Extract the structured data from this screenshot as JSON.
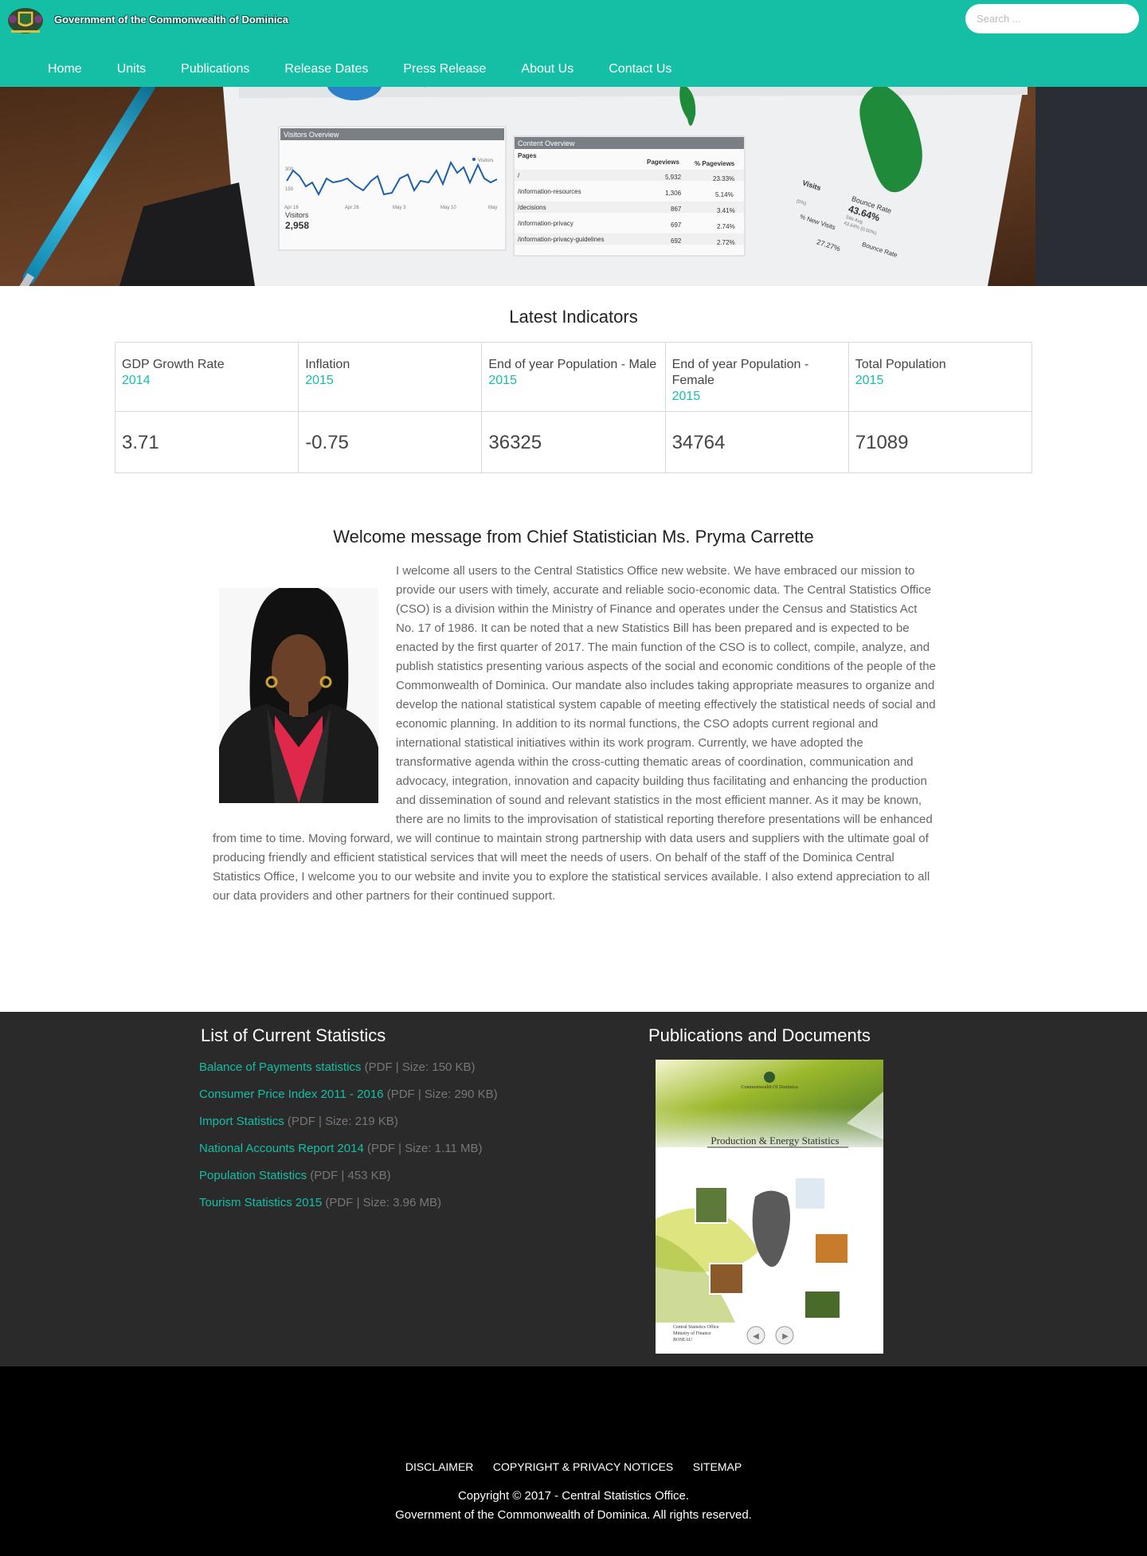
{
  "header": {
    "site_title": "Government of the Commonwealth of Dominica",
    "search_placeholder": "Search ...",
    "nav": [
      "Home",
      "Units",
      "Publications",
      "Release Dates",
      "Press Release",
      "About Us",
      "Contact Us"
    ]
  },
  "hero": {
    "visitors_title": "Visitors Overview",
    "visitors_label": "Visitors",
    "visitors_value": "2,958",
    "visitors_legend": "Visitors",
    "chart_y_ticks": [
      "300",
      "150"
    ],
    "chart_x_ticks": [
      "Apr 16",
      "Apr 26",
      "May 3",
      "May 10",
      "May"
    ],
    "content_title": "Content Overview",
    "content_headers": [
      "Pages",
      "Pageviews",
      "% Pageviews"
    ],
    "content_rows": [
      [
        "/",
        "5,932",
        "23.33%"
      ],
      [
        "/information-resources",
        "1,306",
        "5.14%"
      ],
      [
        "/decisions",
        "867",
        "3.41%"
      ],
      [
        "/information-privacy",
        "697",
        "2.74%"
      ],
      [
        "/information-privacy-guidelines",
        "692",
        "2.72%"
      ]
    ],
    "visits_label": "Visits",
    "bounce_label": "Bounce Rate",
    "bounce_value": "43.64%",
    "bounce_sub": "Site Avg",
    "bounce_avg": "43.64% (0.00%)",
    "new_visits_label": "% New Visits",
    "new_visits_value": "27.27%",
    "bounce_label_2": "Bounce Rate",
    "small_pct": "(0%)",
    "arrow_glyph": "»"
  },
  "indicators": {
    "title": "Latest Indicators",
    "items": [
      {
        "label": "GDP Growth Rate",
        "year": "2014",
        "value": "3.71"
      },
      {
        "label": "Inflation",
        "year": "2015",
        "value": "-0.75"
      },
      {
        "label": "End of year Population - Male",
        "year": "2015",
        "value": "36325"
      },
      {
        "label": "End of year Population - Female",
        "year": "2015",
        "value": "34764"
      },
      {
        "label": "Total Population",
        "year": "2015",
        "value": "71089"
      }
    ]
  },
  "welcome": {
    "title": "Welcome message from Chief Statistician Ms. Pryma Carrette",
    "body": " I welcome all users to the Central Statistics Office new website. We have embraced our mission to provide our users with timely, accurate and reliable socio-economic data. The Central Statistics Office (CSO) is a division within the Ministry of Finance and operates under the Census and Statistics Act No. 17 of 1986. It can be noted that a new Statistics Bill has been prepared and is expected to be enacted by the first quarter of 2017. The main function of the CSO is to collect, compile, analyze, and publish statistics presenting various aspects of the social and economic conditions of the people of the Commonwealth of Dominica. Our mandate also includes taking appropriate measures to organize and develop the national statistical system capable of meeting effectively the statistical needs of social and economic planning. In addition to its normal functions, the CSO adopts current regional and international statistical initiatives within its work program. Currently, we have adopted the transformative agenda within the cross-cutting thematic areas of coordination, communication and advocacy, integration, innovation and capacity building thus facilitating and enhancing the production and dissemination of sound and relevant statistics in the most efficient manner. As it may be known, there are no limits to the improvisation of statistical reporting therefore presentations will be enhanced from time to time. Moving forward, we will continue to maintain strong partnership with data users and suppliers with the ultimate goal of producing friendly and efficient statistical services that will meet the needs of users. On behalf of the staff of the Dominica Central Statistics Office, I welcome you to our website and invite you to explore the statistical services available. I also extend appreciation to all our data providers and other partners for their continued support."
  },
  "stats": {
    "title": "List of Current Statistics",
    "items": [
      {
        "name": "Balance of Payments statistics",
        "meta": " (PDF | Size: 150 KB)"
      },
      {
        "name": "Consumer Price Index 2011 - 2016",
        "meta": " (PDF | Size: 290 KB)"
      },
      {
        "name": "Import Statistics",
        "meta": " (PDF | Size: 219 KB)"
      },
      {
        "name": "National Accounts Report 2014",
        "meta": " (PDF | Size: 1.11 MB)"
      },
      {
        "name": "Population Statistics",
        "meta": " (PDF | 453 KB)"
      },
      {
        "name": "Tourism Statistics 2015",
        "meta": " (PDF | Size: 3.96 MB)"
      }
    ]
  },
  "publications": {
    "title": "Publications and Documents",
    "cover_org": "Commonwealth Of Dominica",
    "cover_title": "Production & Energy Statistics",
    "cover_footer": [
      "Central Statistics Office",
      "Ministry of Finance",
      "ROSEAU"
    ],
    "prev_glyph": "◀",
    "next_glyph": "▶"
  },
  "footer": {
    "links": [
      "DISCLAIMER",
      "COPYRIGHT & PRIVACY NOTICES",
      "SITEMAP"
    ],
    "copyright_1": "Copyright © 2017 - Central Statistics Office.",
    "copyright_2": "Government of the Commonwealth of Dominica. All rights reserved."
  },
  "colors": {
    "accent": "#14bfa6",
    "band": "#2a2a2a",
    "footer": "#000000"
  }
}
